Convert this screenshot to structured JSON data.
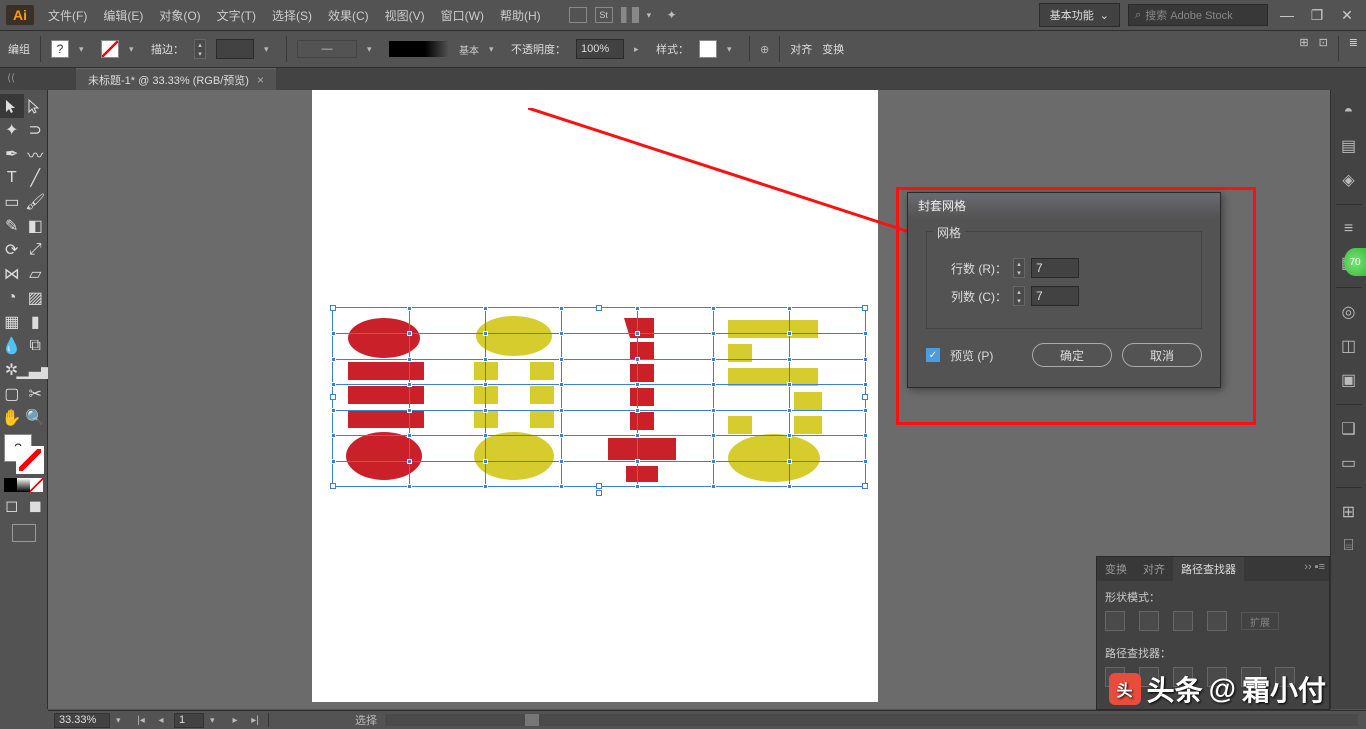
{
  "app": {
    "logo": "Ai"
  },
  "menu": {
    "items": [
      {
        "id": "file",
        "label": "文件(F)"
      },
      {
        "id": "edit",
        "label": "编辑(E)"
      },
      {
        "id": "object",
        "label": "对象(O)"
      },
      {
        "id": "type",
        "label": "文字(T)"
      },
      {
        "id": "select",
        "label": "选择(S)"
      },
      {
        "id": "effect",
        "label": "效果(C)"
      },
      {
        "id": "view",
        "label": "视图(V)"
      },
      {
        "id": "window",
        "label": "窗口(W)"
      },
      {
        "id": "help",
        "label": "帮助(H)"
      }
    ],
    "workspace": "基本功能",
    "search_placeholder": "搜索 Adobe Stock"
  },
  "controlbar": {
    "selection_label": "编组",
    "fill_value": "?",
    "stroke_label": "描边：",
    "stroke_weight": "",
    "brush_style": "基本",
    "opacity_label": "不透明度：",
    "opacity_value": "100%",
    "style_label": "样式：",
    "align_label": "对齐",
    "transform_label": "变换"
  },
  "tab": {
    "title": "未标题-1* @ 33.33% (RGB/预览)"
  },
  "dialog": {
    "title": "封套网格",
    "group_label": "网格",
    "rows_label": "行数 (R)：",
    "rows_value": "7",
    "cols_label": "列数 (C)：",
    "cols_value": "7",
    "preview_label": "预览 (P)",
    "ok_label": "确定",
    "cancel_label": "取消"
  },
  "pathfinder": {
    "tabs": [
      {
        "id": "transform",
        "label": "变换"
      },
      {
        "id": "align",
        "label": "对齐"
      },
      {
        "id": "pathfinder",
        "label": "路径查找器"
      }
    ],
    "shape_mode_label": "形状模式：",
    "expand_label": "扩展",
    "pathfinders_label": "路径查找器："
  },
  "status": {
    "zoom": "33.33%",
    "page": "1",
    "tool": "选择"
  },
  "toolbox": {
    "fill_char": "?"
  },
  "dock": {
    "icons": [
      {
        "id": "color",
        "glyph": "◓"
      },
      {
        "id": "swatches",
        "glyph": "▤"
      },
      {
        "id": "brushes",
        "glyph": "◈"
      },
      {
        "id": "symbols",
        "glyph": "☼"
      },
      {
        "id": "stroke",
        "glyph": "≡"
      },
      {
        "id": "gradient",
        "glyph": "▦"
      },
      {
        "id": "transparency",
        "glyph": "◫"
      },
      {
        "id": "appearance",
        "glyph": "◎"
      },
      {
        "id": "graphic-styles",
        "glyph": "▣"
      },
      {
        "id": "layers",
        "glyph": "❑"
      },
      {
        "id": "assets",
        "glyph": "⬚"
      },
      {
        "id": "artboards",
        "glyph": "▭"
      },
      {
        "id": "libraries",
        "glyph": "⊞"
      }
    ]
  },
  "watermark": {
    "prefix": "头条",
    "at": "@",
    "name": "霜小付"
  }
}
